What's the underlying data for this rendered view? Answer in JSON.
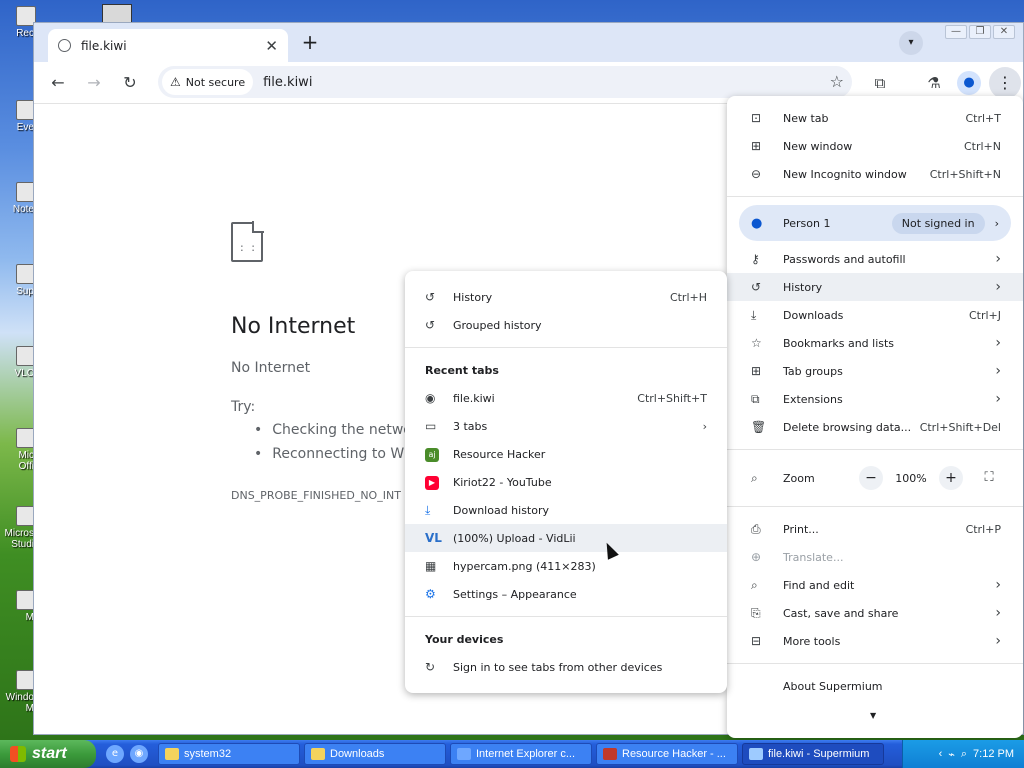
{
  "desktop": {
    "icons": [
      "Rec",
      "Eve",
      "Note",
      "Sup",
      "VLC",
      "Mic Offi",
      "Micros Studi",
      "M",
      "Windo M"
    ]
  },
  "browser": {
    "tab_title": "file.kiwi",
    "url": "file.kiwi",
    "security_label": "Not secure"
  },
  "page": {
    "title": "No Internet",
    "subtitle": "No Internet",
    "try_label": "Try:",
    "suggestions": [
      "Checking the networ",
      "Reconnecting to Wi-"
    ],
    "error_code": "DNS_PROBE_FINISHED_NO_INT"
  },
  "menu": {
    "new_tab": {
      "label": "New tab",
      "shortcut": "Ctrl+T"
    },
    "new_window": {
      "label": "New window",
      "shortcut": "Ctrl+N"
    },
    "incognito": {
      "label": "New Incognito window",
      "shortcut": "Ctrl+Shift+N"
    },
    "person": {
      "label": "Person 1",
      "badge": "Not signed in"
    },
    "passwords": {
      "label": "Passwords and autofill"
    },
    "history": {
      "label": "History"
    },
    "downloads": {
      "label": "Downloads",
      "shortcut": "Ctrl+J"
    },
    "bookmarks": {
      "label": "Bookmarks and lists"
    },
    "tab_groups": {
      "label": "Tab groups"
    },
    "extensions": {
      "label": "Extensions"
    },
    "delete_data": {
      "label": "Delete browsing data...",
      "shortcut": "Ctrl+Shift+Del"
    },
    "zoom": {
      "label": "Zoom",
      "value": "100%"
    },
    "print": {
      "label": "Print...",
      "shortcut": "Ctrl+P"
    },
    "translate": {
      "label": "Translate..."
    },
    "find_edit": {
      "label": "Find and edit"
    },
    "cast_save": {
      "label": "Cast, save and share"
    },
    "more_tools": {
      "label": "More tools"
    },
    "about": {
      "label": "About Supermium"
    }
  },
  "history_menu": {
    "history": {
      "label": "History",
      "shortcut": "Ctrl+H"
    },
    "grouped": {
      "label": "Grouped history"
    },
    "recent_heading": "Recent tabs",
    "recent": [
      {
        "label": "file.kiwi",
        "shortcut": "Ctrl+Shift+T",
        "icon": "globe-icon"
      },
      {
        "label": "3 tabs",
        "icon": "window-icon"
      },
      {
        "label": "Resource Hacker",
        "icon": "resource-hacker-icon"
      },
      {
        "label": "Kiriot22 - YouTube",
        "icon": "youtube-icon"
      },
      {
        "label": "Download history",
        "icon": "download-icon"
      },
      {
        "label": "(100%) Upload - VidLii",
        "icon": "vidlii-icon"
      },
      {
        "label": "hypercam.png (411×283)",
        "icon": "image-icon"
      },
      {
        "label": "Settings – Appearance",
        "icon": "settings-icon"
      }
    ],
    "devices_heading": "Your devices",
    "devices_text": "Sign in to see tabs from other devices"
  },
  "taskbar": {
    "start": "start",
    "tasks": [
      "system32",
      "Downloads",
      "Internet Explorer c...",
      "Resource Hacker - ...",
      "file.kiwi - Supermium"
    ],
    "clock": "7:12 PM"
  }
}
